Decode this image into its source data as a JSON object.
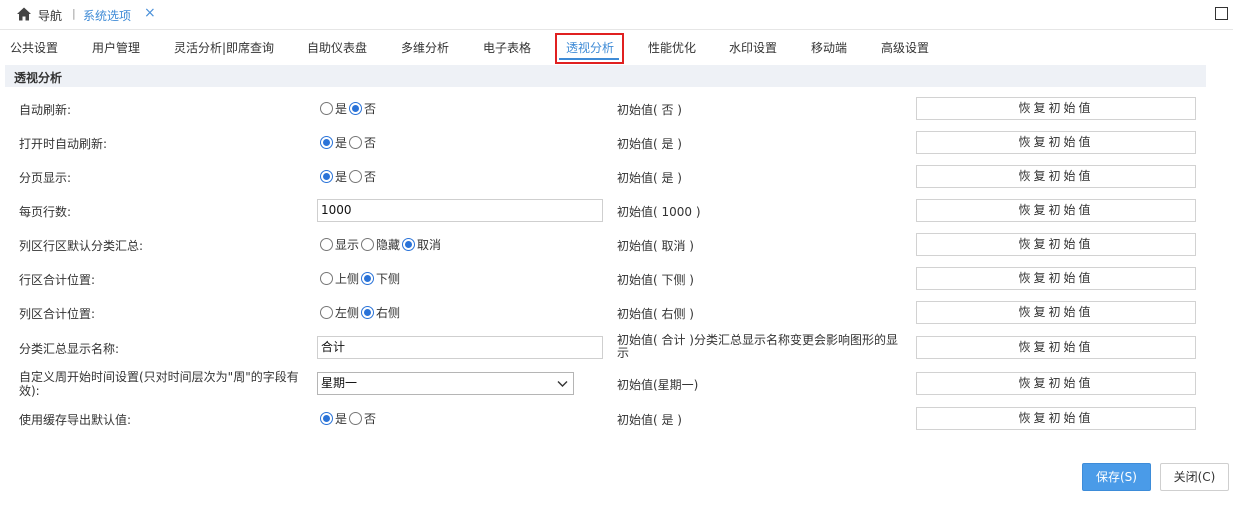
{
  "topbar": {
    "nav_label": "导航",
    "separator": "|",
    "active_tab": "系统选项",
    "close_symbol": "×"
  },
  "tabs": [
    {
      "label": "公共设置"
    },
    {
      "label": "用户管理"
    },
    {
      "label": "灵活分析|即席查询"
    },
    {
      "label": "自助仪表盘"
    },
    {
      "label": "多维分析"
    },
    {
      "label": "电子表格"
    },
    {
      "label": "透视分析",
      "active": true
    },
    {
      "label": "性能优化"
    },
    {
      "label": "水印设置"
    },
    {
      "label": "移动端"
    },
    {
      "label": "高级设置"
    }
  ],
  "section": {
    "title": "透视分析"
  },
  "reset_label": "恢复初始值",
  "rows": [
    {
      "label": "自动刷新:",
      "options": [
        "是",
        "否"
      ],
      "selected": 1,
      "initial": "初始值( 否 )"
    },
    {
      "label": "打开时自动刷新:",
      "options": [
        "是",
        "否"
      ],
      "selected": 0,
      "initial": "初始值( 是 )"
    },
    {
      "label": "分页显示:",
      "options": [
        "是",
        "否"
      ],
      "selected": 0,
      "initial": "初始值( 是 )"
    },
    {
      "label": "每页行数:",
      "value": "1000",
      "initial": "初始值( 1000 )"
    },
    {
      "label": "列区行区默认分类汇总:",
      "options": [
        "显示",
        "隐藏",
        "取消"
      ],
      "selected": 2,
      "initial": "初始值( 取消 )"
    },
    {
      "label": "行区合计位置:",
      "options": [
        "上侧",
        "下侧"
      ],
      "selected": 1,
      "initial": "初始值( 下侧 )"
    },
    {
      "label": "列区合计位置:",
      "options": [
        "左侧",
        "右侧"
      ],
      "selected": 1,
      "initial": "初始值( 右侧 )"
    },
    {
      "label": "分类汇总显示名称:",
      "value": "合计",
      "initial": "初始值( 合计 )分类汇总显示名称变更会影响图形的显示"
    },
    {
      "label": "自定义周开始时间设置(只对时间层次为\"周\"的字段有效):",
      "select_value": "星期一",
      "initial": "初始值(星期一)"
    },
    {
      "label": "使用缓存导出默认值:",
      "options": [
        "是",
        "否"
      ],
      "selected": 0,
      "initial": "初始值( 是 )"
    }
  ],
  "buttons": {
    "save": "保存(S)",
    "close": "关闭(C)"
  },
  "colors": {
    "accent": "#3f8bd6",
    "radio_checked": "#2a73d8",
    "save_bg": "#4a9be8",
    "highlight_border": "#e02020",
    "section_bg": "#eef1f6"
  }
}
